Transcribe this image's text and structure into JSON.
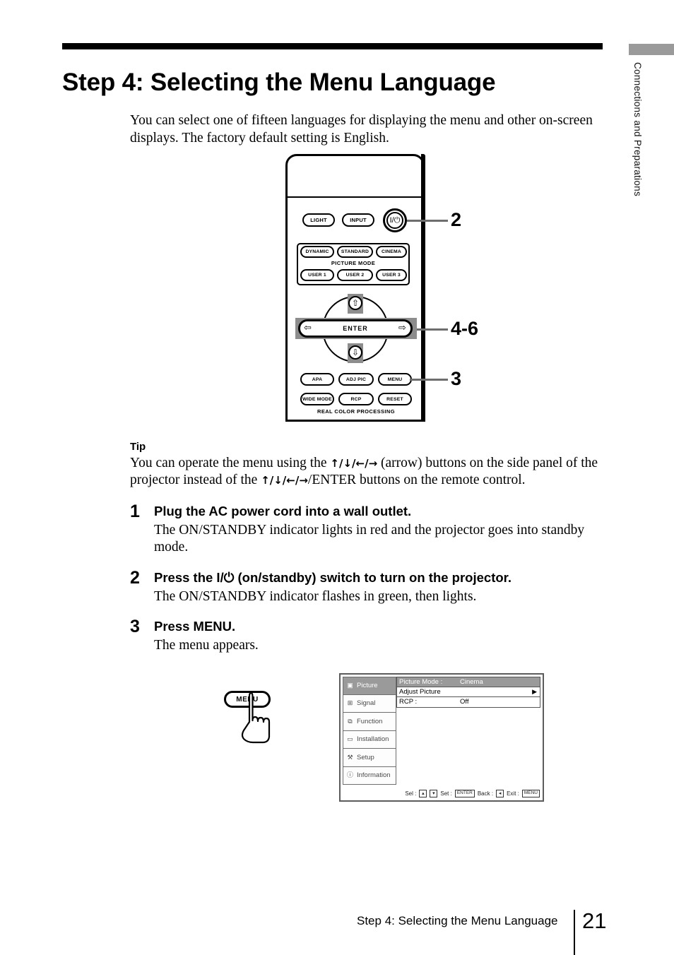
{
  "side_tab": {
    "text": "Connections and Preparations",
    "block_color": "#9a9a9a"
  },
  "header": {
    "title": "Step 4: Selecting the Menu Language"
  },
  "intro": {
    "paragraph": "You can select one of fifteen languages for displaying the menu and other on-screen displays. The factory default setting is English."
  },
  "remote": {
    "buttons": {
      "light": "LIGHT",
      "input": "INPUT",
      "power_symbol": "I/⏻",
      "dynamic": "DYNAMIC",
      "standard": "STANDARD",
      "cinema": "CINEMA",
      "picture_mode_label": "PICTURE MODE",
      "user1": "USER 1",
      "user2": "USER 2",
      "user3": "USER 3",
      "enter": "ENTER",
      "up_arrow": "⇧",
      "down_arrow": "⇩",
      "left_arrow": "⇦",
      "right_arrow": "⇨",
      "apa": "APA",
      "adj_pic": "ADJ PIC",
      "menu": "MENU",
      "wide_mode": "WIDE MODE",
      "rcp": "RCP",
      "reset": "RESET",
      "rcp_footer_label": "REAL COLOR PROCESSING"
    },
    "callouts": {
      "power": "2",
      "pad": "4-6",
      "menu": "3"
    }
  },
  "tip": {
    "title": "Tip",
    "line1_pre": "You can operate the menu using the ",
    "arrows1": "↑/↓/←/→",
    "line1_post": " (arrow) buttons on the side panel of",
    "line2_pre": "the projector instead of the ",
    "arrows2": "↑/↓/←/→",
    "line2_post": "/ENTER buttons on the remote control."
  },
  "steps": [
    {
      "num": "1",
      "head": "Plug the AC power cord into a wall outlet.",
      "body": "The ON/STANDBY indicator lights in red and the projector goes into standby mode."
    },
    {
      "num": "2",
      "head_pre": "Press the I/",
      "head_symbol": "⏻",
      "head_post": " (on/standby) switch to turn on the projector.",
      "body": "The ON/STANDBY indicator flashes in green, then lights."
    },
    {
      "num": "3",
      "head": "Press MENU.",
      "body": "The menu appears."
    }
  ],
  "menu_press": {
    "button_label": "MENU"
  },
  "osd": {
    "sidebar": [
      {
        "icon": "picture-icon",
        "glyph": "▣",
        "label": "Picture",
        "selected": true
      },
      {
        "icon": "signal-icon",
        "glyph": "⊞",
        "label": "Signal",
        "selected": false
      },
      {
        "icon": "function-icon",
        "glyph": "⧉",
        "label": "Function",
        "selected": false
      },
      {
        "icon": "installation-icon",
        "glyph": "▭",
        "label": "Installation",
        "selected": false
      },
      {
        "icon": "setup-icon",
        "glyph": "⚒",
        "label": "Setup",
        "selected": false
      },
      {
        "icon": "information-icon",
        "glyph": "ⓘ",
        "label": "Information",
        "selected": false
      }
    ],
    "rows": [
      {
        "label": "Picture Mode :",
        "value": "Cinema",
        "highlighted": true,
        "chevron": ""
      },
      {
        "label": "Adjust Picture",
        "value": "",
        "highlighted": false,
        "chevron": "▶"
      },
      {
        "label": "RCP :",
        "value": "Off",
        "highlighted": false,
        "chevron": ""
      }
    ],
    "status": {
      "sel_label": "Sel :",
      "sel_key_up": "▴",
      "sel_key_down": "▾",
      "set_label": "Set :",
      "set_key": "ENTER",
      "back_label": "Back :",
      "back_key": "◂",
      "exit_label": "Exit :",
      "exit_key": "MENU"
    }
  },
  "footer": {
    "text": "Step 4: Selecting the Menu Language",
    "page_number": "21"
  }
}
